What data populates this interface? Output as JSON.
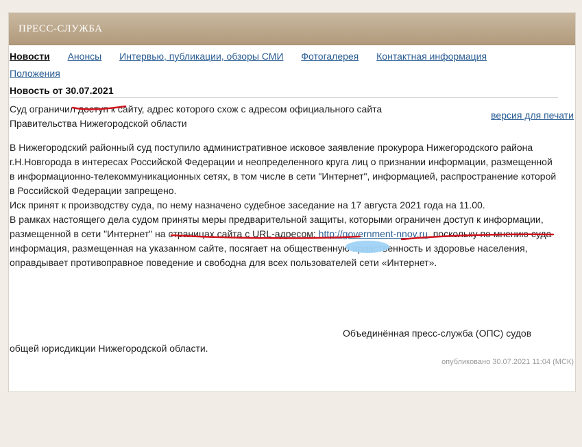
{
  "header": {
    "title": "ПРЕСС-СЛУЖБА"
  },
  "tabs": [
    {
      "label": "Новости"
    },
    {
      "label": "Анонсы"
    },
    {
      "label": "Интервью, публикации, обзоры СМИ"
    },
    {
      "label": "Фотогалерея"
    },
    {
      "label": "Контактная информация"
    },
    {
      "label": "Положения"
    }
  ],
  "news": {
    "date_prefix": "Новость от",
    "date": "30.07.2021",
    "headline": "Суд ограничил доступ к сайту, адрес которого схож с адресом официального сайта Правительства Нижегородской области",
    "print_label": "версия для печати",
    "para1": "В Нижегородский районный суд поступило административное исковое заявление прокурора Нижегородского района г.Н.Новгорода в интересах Российской Федерации и неопределенного круга лиц о признании информации, размещенной в информационно-телекоммуникационных сетях, в том числе в сети \"Интернет\", информацией, распространение которой в Российской Федерации запрещено.",
    "para2": "Иск принят к производству суда, по нему назначено судебное заседание на 17 августа 2021 года на 11.00.",
    "para3_before": "В рамках настоящего дела судом приняты меры предварительной защиты, которыми ограничен доступ к информации, размещенной в сети \"Интернет\" на страницах сайта с URL-адресом: ",
    "para3_link": "http://government-nnov.ru",
    "para3_after": ", поскольку по мнению суда информация, размещенная на указанном сайте, посягает на общественную нравственность и здоровье населения, оправдывает противоправное поведение и свободна для всех пользователей сети «Интернет».",
    "signature_line1": "Объединённая пресс-служба (ОПС) судов",
    "signature_line2": "общей юрисдикции Нижегородской области.",
    "published": "опубликовано 30.07.2021 11:04 (МСК)"
  },
  "colors": {
    "header_bg": "#b8a385",
    "link": "#2a5d93",
    "annotation_red": "#d0141e",
    "redaction_blue": "#9fd3f5"
  }
}
